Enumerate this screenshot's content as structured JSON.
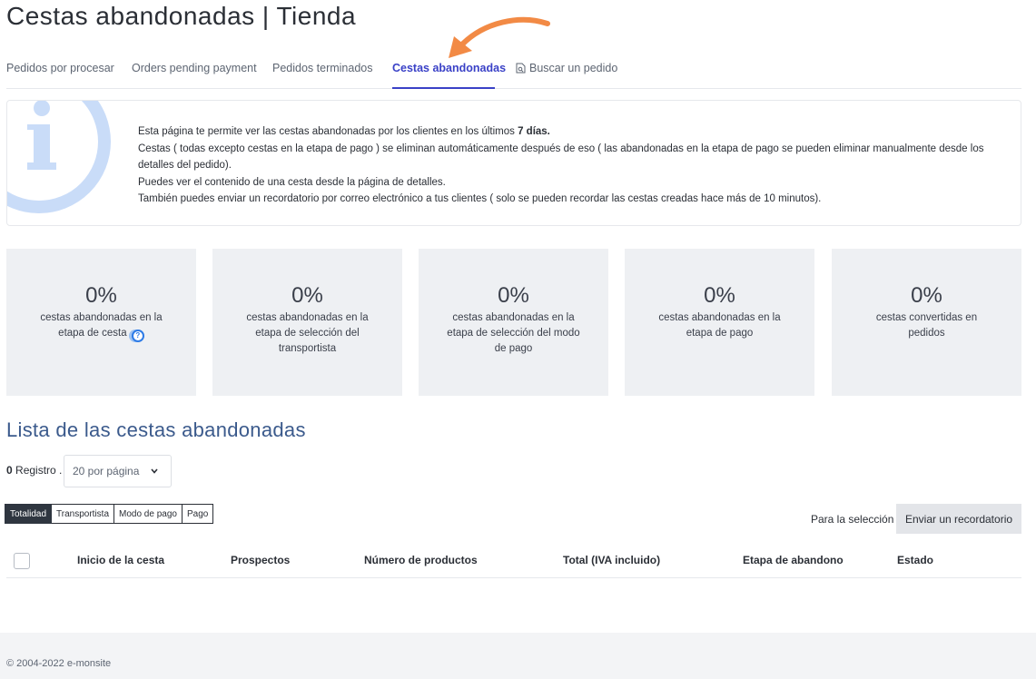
{
  "page": {
    "title": "Cestas abandonadas | Tienda"
  },
  "tabs": [
    {
      "label": "Pedidos por procesar"
    },
    {
      "label": "Orders pending payment"
    },
    {
      "label": "Pedidos terminados"
    },
    {
      "label": "Cestas abandonadas",
      "active": true
    },
    {
      "label": "Buscar un pedido",
      "icon": "document-search-icon"
    }
  ],
  "info": {
    "line1_prefix": "Esta página te permite ver las cestas abandonadas por los clientes en los últimos ",
    "line1_bold": "7 días.",
    "line2": "Cestas ( todas excepto cestas en la etapa de pago ) se eliminan automáticamente después de eso ( las abandonadas en la etapa de pago se pueden eliminar manualmente desde los detalles del pedido).",
    "line3": "Puedes ver el contenido de una cesta desde la página de detalles.",
    "line4": "También puedes enviar un recordatorio por correo electrónico a tus clientes ( solo se pueden recordar las cestas creadas hace más de 10 minutos)."
  },
  "stats": [
    {
      "value": "0%",
      "label": "cestas abandonadas en la etapa de cesta"
    },
    {
      "value": "0%",
      "label": "cestas abandonadas en la etapa de selección del transportista"
    },
    {
      "value": "0%",
      "label": "cestas abandonadas en la etapa de selección del modo de pago"
    },
    {
      "value": "0%",
      "label": "cestas abandonadas en la etapa de pago"
    },
    {
      "value": "0%",
      "label": "cestas convertidas en pedidos"
    }
  ],
  "list": {
    "title": "Lista de las cestas abandonadas",
    "record_count": "0",
    "record_label": " Registro .",
    "per_page": "20 por página"
  },
  "filters": [
    {
      "label": "Totalidad",
      "active": true
    },
    {
      "label": "Transportista"
    },
    {
      "label": "Modo de pago"
    },
    {
      "label": "Pago"
    }
  ],
  "selection": {
    "label": "Para la selección",
    "reminder_button": "Enviar un recordatorio"
  },
  "table": {
    "columns": [
      "Inicio de la cesta",
      "Prospectos",
      "Número de productos",
      "Total (IVA incluido)",
      "Etapa de abandono",
      "Estado"
    ]
  },
  "footer": {
    "copyright": "© 2004-2022 e-monsite"
  },
  "colors": {
    "accent": "#3a41c7",
    "arrow": "#f28a45",
    "info_graphic": "#c9dcf8"
  }
}
